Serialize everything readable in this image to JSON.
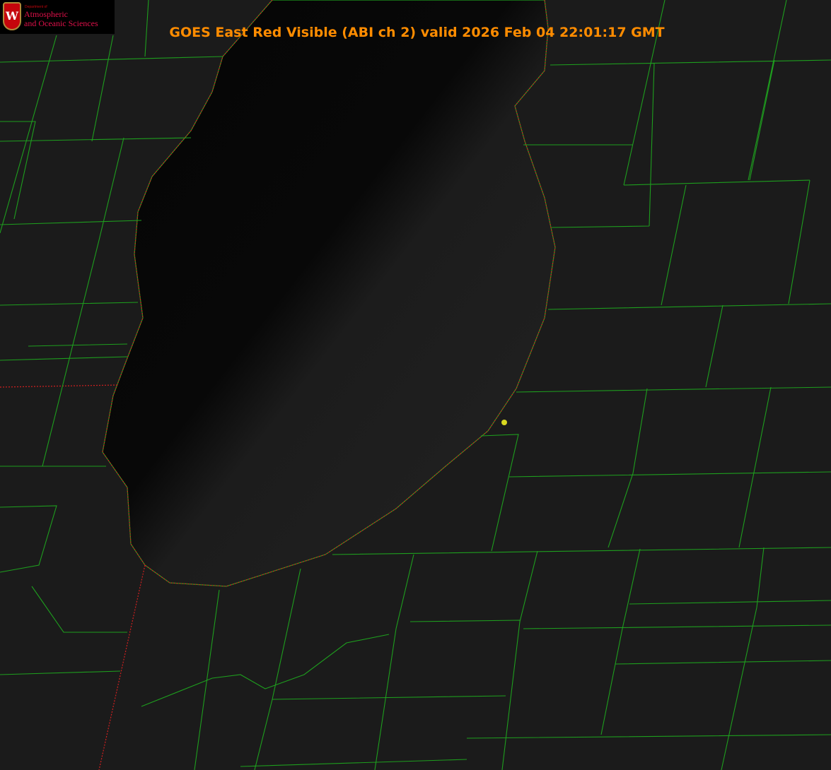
{
  "title": "GOES East Red Visible (ABI ch 2) valid 2026 Feb 04 22:01:17 GMT",
  "logo": {
    "department": "Department of",
    "line1": "Atmospheric",
    "line2": "and Oceanic Sciences",
    "emblem": "W"
  },
  "colors": {
    "title": "#ff8c00",
    "county_lines": "#1e9e1e",
    "state_lines": "#d02020",
    "marker": "#d8d820"
  }
}
